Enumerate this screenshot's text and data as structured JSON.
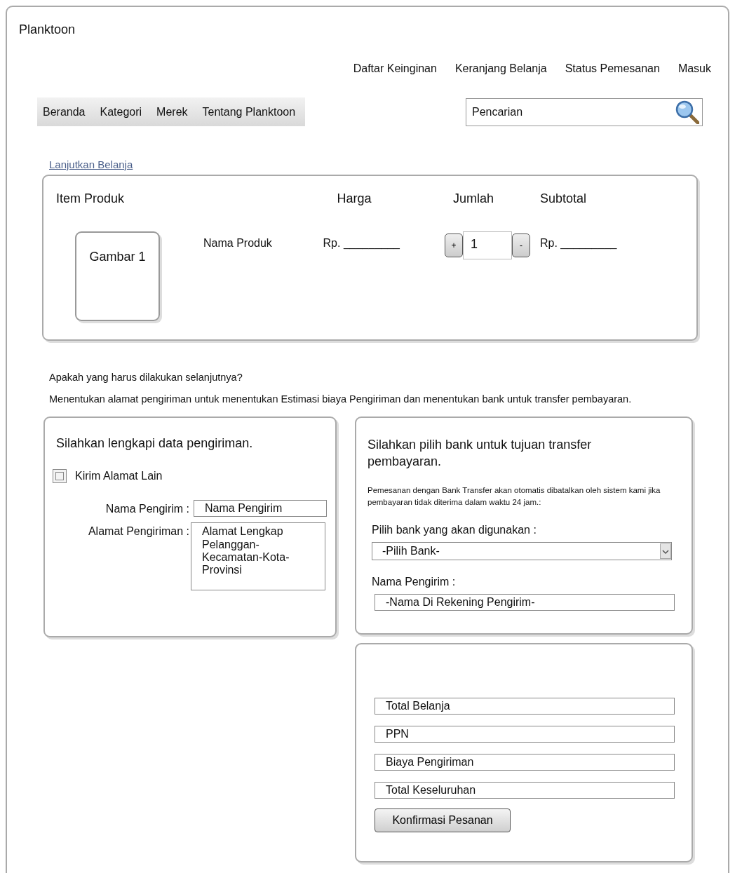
{
  "site_title": "Planktoon",
  "top_links": [
    "Daftar Keinginan",
    "Keranjang Belanja",
    "Status Pemesanan",
    "Masuk"
  ],
  "nav": [
    "Beranda",
    "Kategori",
    "Merek",
    "Tentang Planktoon"
  ],
  "search": {
    "placeholder": "Pencarian"
  },
  "back_link": "Lanjutkan Belanja",
  "cart": {
    "columns": [
      "Item Produk",
      "Harga",
      "Jumlah",
      "Subtotal"
    ],
    "rows": [
      {
        "image_label": "Gambar 1",
        "name": "Nama Produk",
        "price": "Rp. _________",
        "quantity": "1",
        "plus": "+",
        "minus": "-",
        "subtotal": "Rp. _________"
      }
    ]
  },
  "question": "Apakah yang harus dilakukan selanjutnya?",
  "instruction": "Menentukan alamat pengiriman untuk menentukan Estimasi biaya Pengiriman dan menentukan bank untuk transfer pembayaran.",
  "shipping": {
    "title": "Silahkan lengkapi data pengiriman.",
    "checkbox": {
      "label": "Kirim Alamat Lain",
      "checked": false
    },
    "fields": [
      {
        "label": "Nama Pengirim :",
        "value": "Nama Pengirim",
        "kind": "input"
      },
      {
        "label": "Alamat Pengiriman :",
        "value": "Alamat Lengkap Pelanggan-Kecamatan-Kota-Provinsi",
        "kind": "textarea"
      }
    ]
  },
  "bank": {
    "title": "Silahkan pilih bank untuk tujuan transfer pembayaran.",
    "note": "Pemesanan dengan Bank Transfer akan otomatis dibatalkan oleh sistem kami jika pembayaran tidak diterima dalam waktu 24 jam.:",
    "select_label": "Pilih bank yang akan digunakan :",
    "select_value": "-Pilih Bank-",
    "name_label": "Nama Pengirim :",
    "name_value": "-Nama Di Rekening Pengirim-"
  },
  "summary": {
    "fields": [
      "Total Belanja",
      "PPN",
      "Biaya Pengiriman",
      "Total Keseluruhan"
    ],
    "button": "Konfirmasi Pesanan"
  }
}
